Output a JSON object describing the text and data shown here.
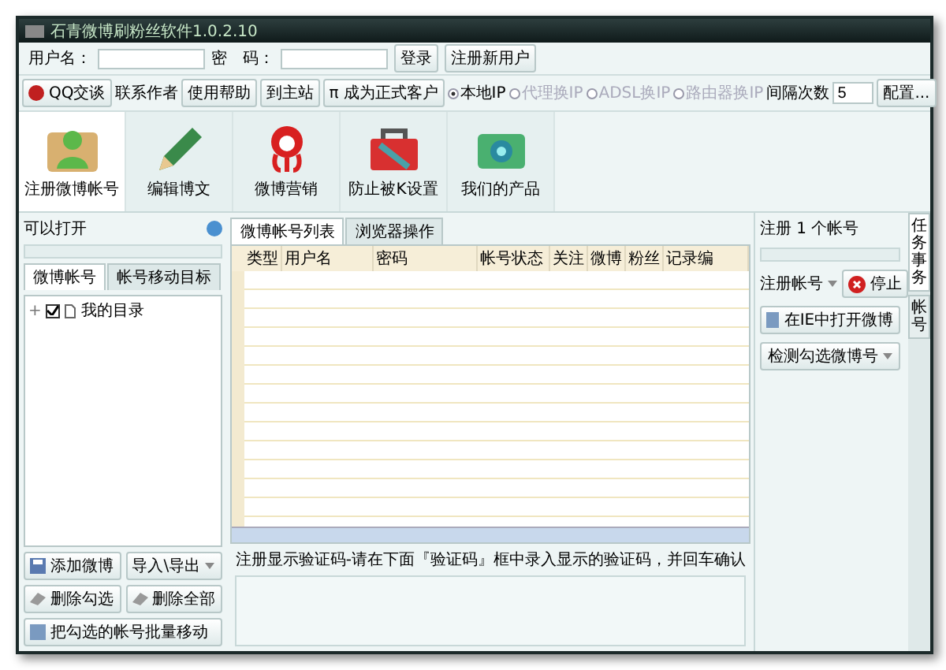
{
  "window": {
    "title": "石青微博刷粉丝软件1.0.2.10"
  },
  "login": {
    "username_label": "用户名：",
    "password_label": "密　码：",
    "login_button": "登录",
    "register_button": "注册新用户"
  },
  "toolbar": {
    "qq_button": "QQ交谈",
    "contact": "联系作者",
    "buttons": [
      "使用帮助",
      "到主站"
    ],
    "upgrade_icon": "π",
    "upgrade": "成为正式客户",
    "ip_modes": [
      {
        "label": "本地IP",
        "selected": true
      },
      {
        "label": "代理换IP",
        "selected": false
      },
      {
        "label": "ADSL换IP",
        "selected": false
      },
      {
        "label": "路由器换IP",
        "selected": false
      }
    ],
    "interval_label": "间隔次数",
    "interval_value": "5",
    "config_button": "配置..."
  },
  "modules": [
    {
      "kind": "register",
      "label": "注册微博帐号",
      "selected": true
    },
    {
      "kind": "edit",
      "label": "编辑博文",
      "selected": false
    },
    {
      "kind": "marketing",
      "label": "微博营销",
      "selected": false
    },
    {
      "kind": "protect",
      "label": "防止被K设置",
      "selected": false
    },
    {
      "kind": "products",
      "label": "我们的产品",
      "selected": false
    }
  ],
  "left_panel": {
    "title": "可以打开",
    "progress": {
      "level": 0
    },
    "tabs": [
      {
        "label": "微博帐号",
        "selected": true
      },
      {
        "label": "帐号移动目标",
        "selected": false
      }
    ],
    "tree": [
      {
        "toggle": "+",
        "label": "我的目录",
        "checked": true,
        "expanded": false
      }
    ],
    "buttons": [
      {
        "label": "添加微博",
        "kind": "add"
      },
      {
        "label": "导入\\导出",
        "kind": "menu"
      },
      {
        "label": "删除勾选",
        "kind": "erase"
      },
      {
        "label": "删除全部",
        "kind": "erase"
      },
      {
        "label": "把勾选的帐号批量移动",
        "kind": "move"
      }
    ]
  },
  "center": {
    "tabs": [
      {
        "label": "微博帐号列表",
        "selected": true
      },
      {
        "label": "浏览器操作",
        "selected": false
      }
    ],
    "table": {
      "columns": [
        "类型",
        "用户名",
        "密码",
        "帐号状态",
        "关注",
        "微博",
        "粉丝",
        "记录编"
      ]
    },
    "message": "注册显示验证码-请在下面『验证码』框中录入显示的验证码，并回车确认"
  },
  "right_panel": {
    "title": "注册 1 个帐号",
    "progress": {
      "level": 0
    },
    "mode": "注册帐号",
    "stop_button": "停止",
    "open_ie_button": "在IE中打开微博",
    "check_button": "检测勾选微博号"
  },
  "side_tabs": [
    {
      "label": "任务事务",
      "selected": true
    },
    {
      "label": "帐号",
      "selected": false
    }
  ]
}
